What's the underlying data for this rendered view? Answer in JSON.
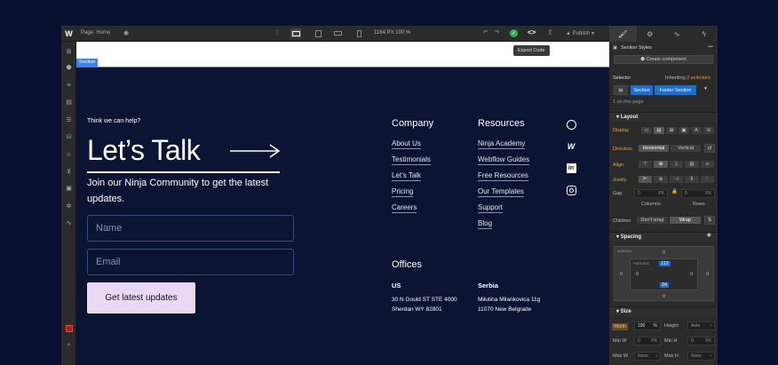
{
  "topbar": {
    "logo": "W",
    "page_label": "Page: Home",
    "dimensions": "1164 PX  100 %",
    "publish": "Publish",
    "dots": "⋮"
  },
  "tooltip": "Export Code",
  "panel_tabs": [
    "brush-icon",
    "gear-icon",
    "interactions-icon",
    "bolt-icon"
  ],
  "canvas": {
    "section_tag": "Section",
    "eyebrow": "Think we can help?",
    "headline": "Let’s Talk",
    "subline": "Join our Ninja Community to get the latest updates.",
    "name_placeholder": "Name",
    "email_placeholder": "Email",
    "cta": "Get latest updates",
    "company": {
      "title": "Company",
      "links": [
        "About Us",
        "Testimonials",
        "Let’s Talk",
        "Pricing",
        "Careers"
      ]
    },
    "resources": {
      "title": "Resources",
      "links": [
        "Ninja Academy",
        "Webflow Guides",
        "Free Resources",
        "Our Templates",
        "Support",
        "Blog"
      ]
    },
    "social": [
      "dribbble-icon",
      "webflow-icon",
      "linkedin-icon",
      "instagram-icon"
    ],
    "offices": {
      "title": "Offices",
      "us": {
        "label": "US",
        "line1": "30 N Gould ST STE 4000",
        "line2": "Sherdan WY 82801"
      },
      "serbia": {
        "label": "Serbia",
        "line1": "Milutina Milankovica 11g",
        "line2": "11070 New Belgrade"
      }
    }
  },
  "panel": {
    "section_styles": "Section Styles",
    "create_component": "Create component",
    "selector": "Selector",
    "inheriting": "Inheriting",
    "inheriting_count": "2 selectors",
    "chip_section": "Section",
    "chip_footer": "Footer Section",
    "on_page": "1 on this page",
    "layout": "Layout",
    "display": "Display",
    "direction": "Direction",
    "horizontal": "Horizontal",
    "vertical": "Vertical",
    "align": "Align",
    "justify": "Justify",
    "gap": "Gap",
    "gap_col": "0",
    "gap_row": "0",
    "px": "PX",
    "columns": "Columns",
    "rows": "Rows",
    "children": "Children",
    "dont_wrap": "Don't wrap",
    "wrap": "Wrap",
    "spacing": "Spacing",
    "margin": "MARGIN",
    "padding": "PADDING",
    "margin_top": "0",
    "margin_left": "0",
    "margin_right": "0",
    "margin_bottom": "0",
    "padding_top": "112",
    "padding_left": "0",
    "padding_right": "0",
    "padding_bottom": "24",
    "size": "Size",
    "width": "Width",
    "width_val": "100",
    "width_unit": "%",
    "height": "Height",
    "auto": "Auto",
    "min_w": "Min W",
    "min_h": "Min H",
    "max_w": "Max W",
    "max_h": "Max H",
    "none": "None",
    "zero": "0"
  }
}
